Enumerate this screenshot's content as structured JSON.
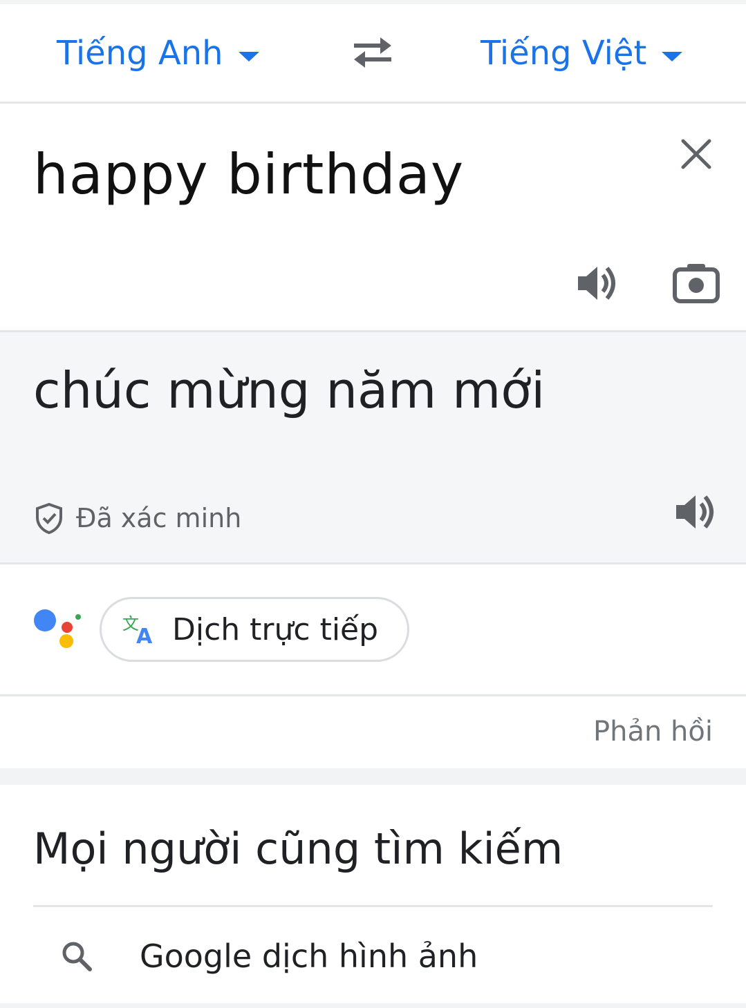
{
  "colors": {
    "accent": "#1a73e8",
    "text_primary": "#202124",
    "text_secondary": "#5f6368",
    "result_background": "#f5f6f8"
  },
  "language_bar": {
    "source_language": "Tiếng Anh",
    "target_language": "Tiếng Việt",
    "swap_icon": "swap-arrows-icon"
  },
  "source": {
    "text": "happy birthday",
    "icons": [
      "close-icon",
      "speaker-icon",
      "camera-icon"
    ]
  },
  "result": {
    "text": "chúc mừng năm mới",
    "verified_label": "Đã xác minh",
    "icons": [
      "shield-check-icon",
      "speaker-icon"
    ]
  },
  "live_translate": {
    "chip_label": "Dịch trực tiếp",
    "icons": [
      "google-assistant-icon",
      "translate-icon"
    ]
  },
  "feedback_label": "Phản hồi",
  "people_also_search": {
    "title": "Mọi người cũng tìm kiếm",
    "items": [
      {
        "label": "Google dịch hình ảnh",
        "icon": "search-icon"
      }
    ]
  }
}
